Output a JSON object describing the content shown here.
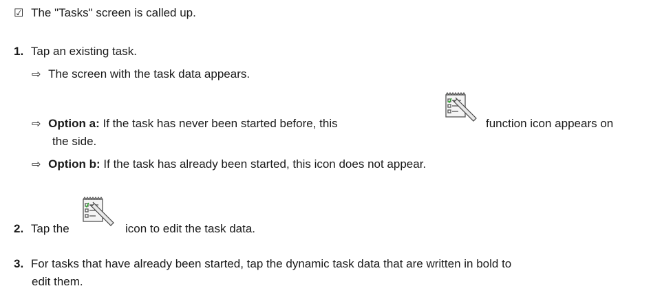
{
  "prerequisite": {
    "symbol": "☑",
    "text": "The \"Tasks\" screen is called up."
  },
  "steps": [
    {
      "number": "1.",
      "text": "Tap an existing task.",
      "results": [
        {
          "text": "The screen with the task data appears."
        },
        {
          "bold": "Option a:",
          "text_before_icon": " If the task has never been started before, this",
          "text_after_icon": "function icon appears on",
          "continuation": "the side."
        },
        {
          "bold": "Option b:",
          "text": " If the task has already been started, this icon does not appear."
        }
      ]
    },
    {
      "number": "2.",
      "text_before_icon": "Tap the",
      "text_after_icon": "icon to edit the task data."
    },
    {
      "number": "3.",
      "text": "For tasks that have already been started, tap the dynamic task data that are written in bold to",
      "continuation": "edit them."
    }
  ],
  "result_arrow": "⇨",
  "icon_name": "edit-task-icon"
}
